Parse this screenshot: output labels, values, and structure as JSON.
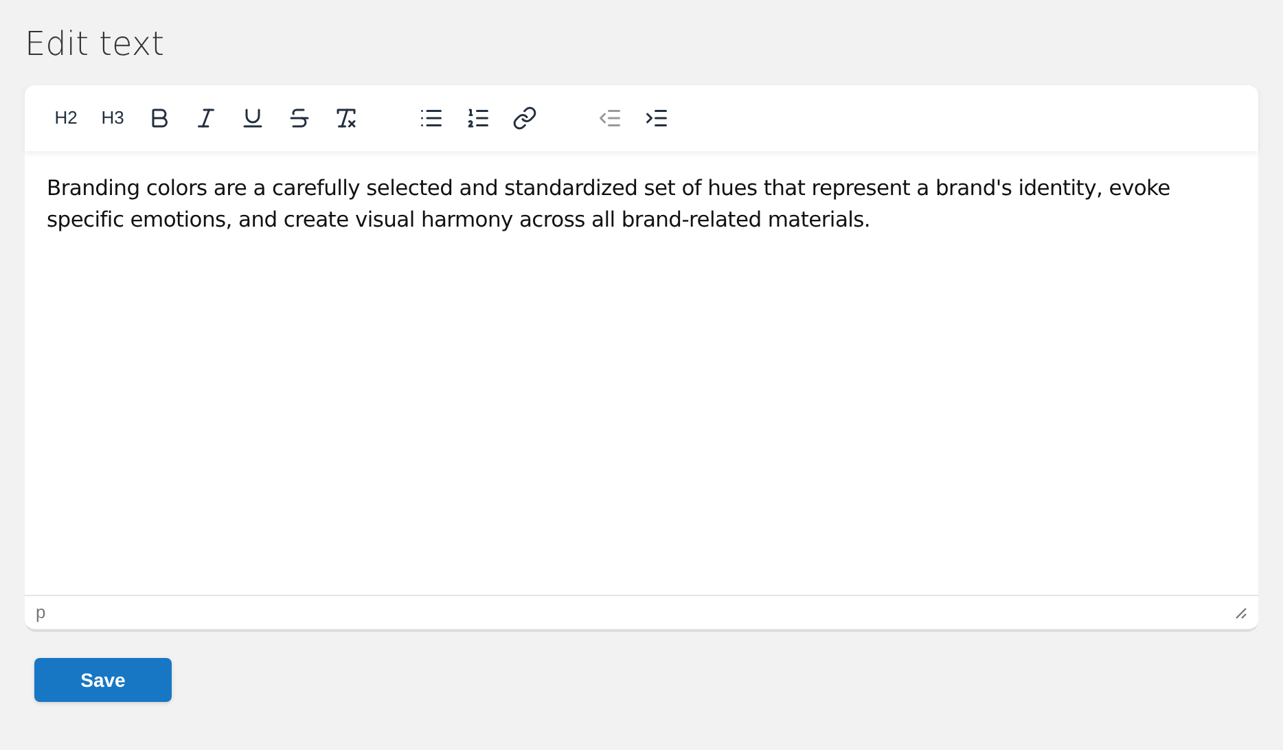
{
  "page": {
    "title": "Edit text"
  },
  "toolbar": {
    "groups": [
      {
        "items": [
          {
            "kind": "heading",
            "label": "H2",
            "disabled": false
          },
          {
            "kind": "heading",
            "label": "H3",
            "disabled": false
          },
          {
            "kind": "bold",
            "disabled": false
          },
          {
            "kind": "italic",
            "disabled": false
          },
          {
            "kind": "underline",
            "disabled": false
          },
          {
            "kind": "strike",
            "disabled": false
          },
          {
            "kind": "clear",
            "disabled": false
          }
        ]
      },
      {
        "items": [
          {
            "kind": "bullets",
            "disabled": false
          },
          {
            "kind": "numbers",
            "disabled": false
          },
          {
            "kind": "link",
            "disabled": false
          }
        ]
      },
      {
        "items": [
          {
            "kind": "outdent",
            "disabled": true
          },
          {
            "kind": "indent",
            "disabled": false
          }
        ]
      }
    ]
  },
  "editor": {
    "content": "Branding colors are a carefully selected and standardized set of hues that represent a brand's identity, evoke specific emotions, and create visual harmony across all brand-related materials.",
    "path": "p"
  },
  "buttons": [
    {
      "label": "Save"
    }
  ]
}
